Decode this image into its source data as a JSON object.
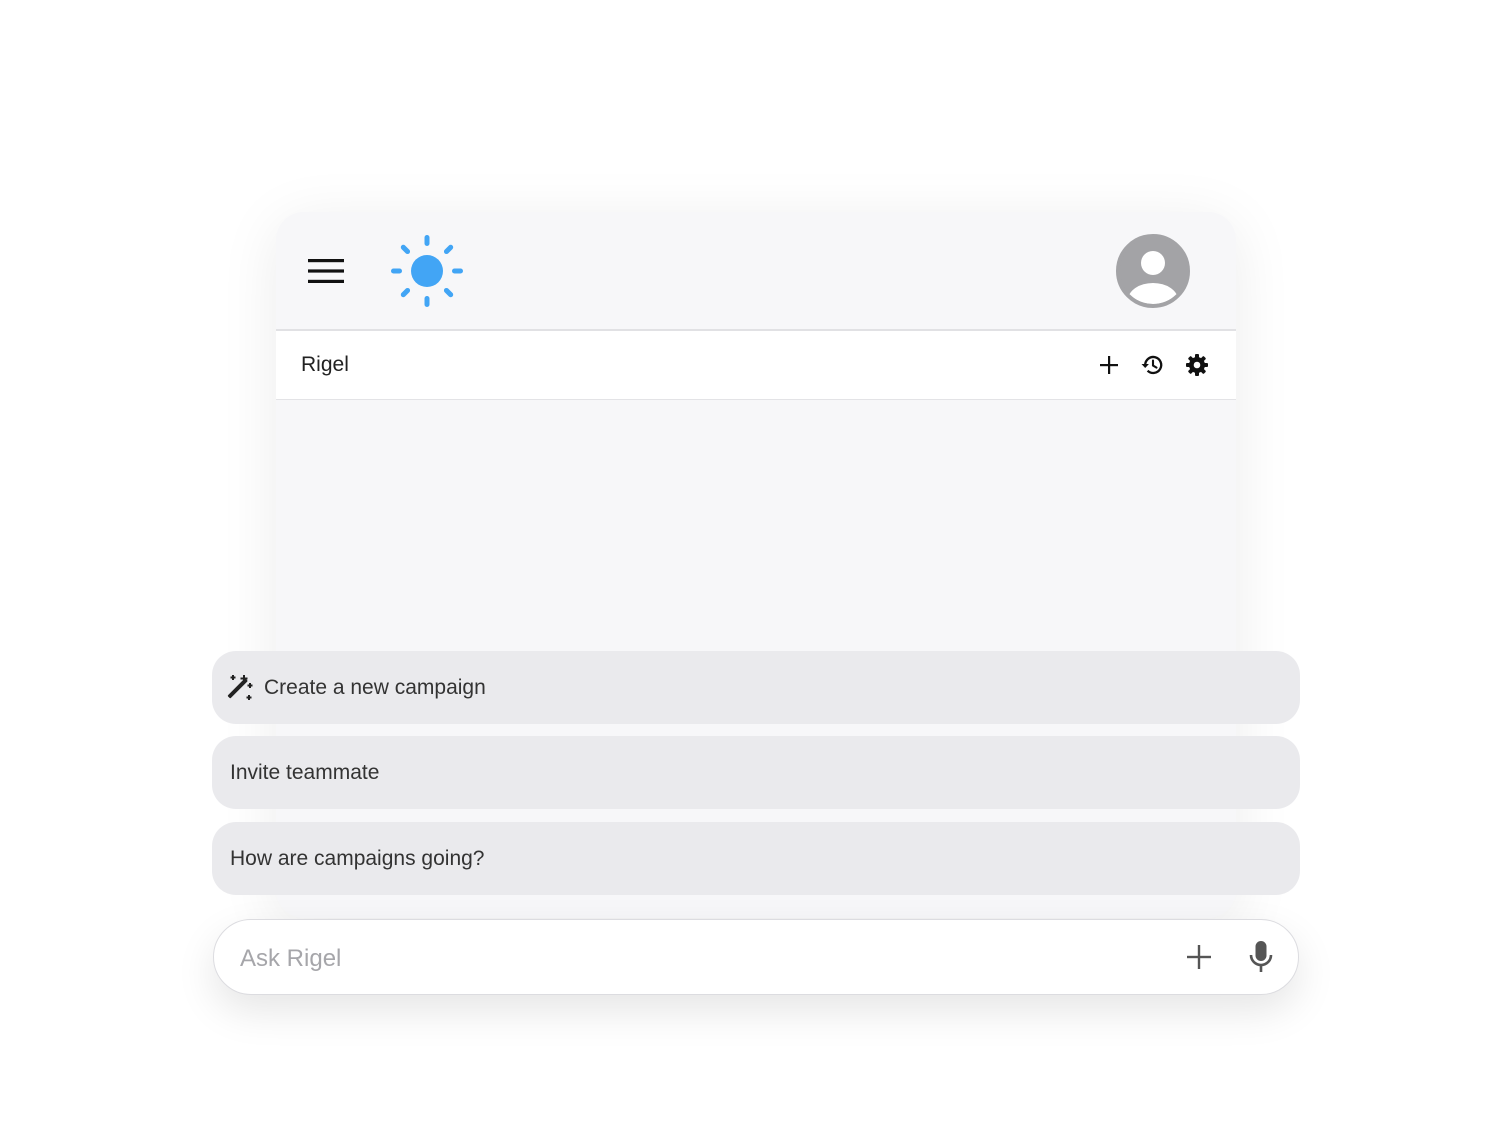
{
  "app": {
    "title": "Rigel"
  },
  "header": {
    "menu_icon": "hamburger-menu-icon",
    "logo_icon": "sun-icon",
    "avatar_icon": "account-circle-icon",
    "logo_color": "#42a5f5",
    "avatar_color": "#a3a3a6"
  },
  "toolbar": {
    "actions": [
      {
        "icon": "plus-icon"
      },
      {
        "icon": "history-icon"
      },
      {
        "icon": "gear-icon"
      }
    ]
  },
  "suggestions": [
    {
      "label": "Create a new campaign",
      "icon": "magic-wand-icon"
    },
    {
      "label": "Invite teammate"
    },
    {
      "label": "How are campaigns going?"
    }
  ],
  "composer": {
    "placeholder": "Ask Rigel",
    "value": "",
    "attach_icon": "plus-icon",
    "voice_icon": "microphone-icon"
  }
}
